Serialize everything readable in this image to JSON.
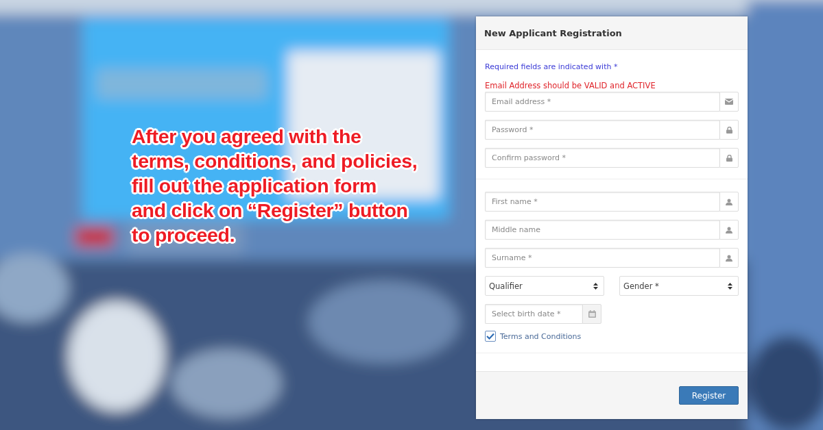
{
  "caption_lines": [
    "After you agreed with the",
    "terms, conditions, and policies,",
    "fill out the application form",
    "and click on “Register” button",
    "to proceed."
  ],
  "form": {
    "title": "New Applicant Registration",
    "required_note": "Required fields are indicated with *",
    "email_note": "Email Address should be VALID and ACTIVE",
    "account_fields": [
      {
        "placeholder": "Email address *",
        "kind": "email"
      },
      {
        "placeholder": "Password *",
        "kind": "password"
      },
      {
        "placeholder": "Confirm password *",
        "kind": "password"
      }
    ],
    "name_fields": [
      {
        "placeholder": "First name *",
        "kind": "person"
      },
      {
        "placeholder": "Middle name",
        "kind": "person"
      },
      {
        "placeholder": "Surname *",
        "kind": "person"
      }
    ],
    "selects": [
      {
        "value": "Qualifier"
      },
      {
        "value": "Gender *"
      }
    ],
    "birth_date": {
      "placeholder": "Select birth date *"
    },
    "terms": {
      "label": "Terms and Conditions",
      "checked": true
    },
    "submit": "Register"
  }
}
